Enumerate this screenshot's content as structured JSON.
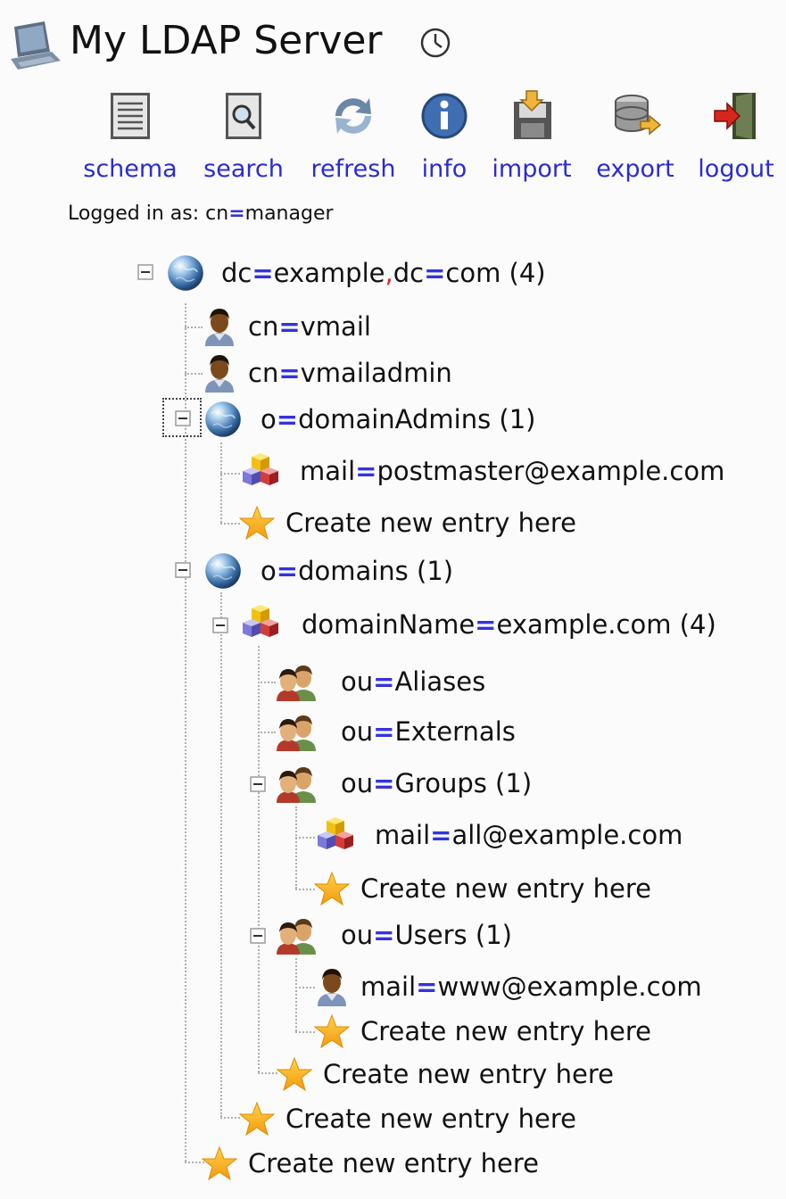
{
  "header": {
    "title": "My LDAP Server",
    "server_icon": "server-computer-icon",
    "clock_icon": "clock-icon"
  },
  "toolbar": [
    {
      "label": "schema",
      "icon": "schema-icon"
    },
    {
      "label": "search",
      "icon": "search-icon"
    },
    {
      "label": "refresh",
      "icon": "refresh-icon"
    },
    {
      "label": "info",
      "icon": "info-icon"
    },
    {
      "label": "import",
      "icon": "import-icon"
    },
    {
      "label": "export",
      "icon": "export-icon"
    },
    {
      "label": "logout",
      "icon": "logout-icon"
    }
  ],
  "login": {
    "prefix": "Logged in as: ",
    "attr": "cn",
    "eq": "=",
    "value": "manager"
  },
  "tree": {
    "root": {
      "attr1": "dc",
      "val1": "example",
      "sep": ",",
      "attr2": "dc",
      "val2": "com",
      "count": " (4)"
    },
    "vmail": {
      "attr": "cn",
      "value": "vmail"
    },
    "vmailadmin": {
      "attr": "cn",
      "value": "vmailadmin"
    },
    "domainAdmins": {
      "attr": "o",
      "value": "domainAdmins",
      "count": " (1)"
    },
    "postmaster": {
      "attr": "mail",
      "value": "postmaster@example.com"
    },
    "domains": {
      "attr": "o",
      "value": "domains",
      "count": " (1)"
    },
    "domainName": {
      "attr": "domainName",
      "value": "example.com",
      "count": " (4)"
    },
    "aliases": {
      "attr": "ou",
      "value": "Aliases"
    },
    "externals": {
      "attr": "ou",
      "value": "Externals"
    },
    "groups": {
      "attr": "ou",
      "value": "Groups",
      "count": " (1)"
    },
    "all": {
      "attr": "mail",
      "value": "all@example.com"
    },
    "users": {
      "attr": "ou",
      "value": "Users",
      "count": " (1)"
    },
    "www": {
      "attr": "mail",
      "value": "www@example.com"
    },
    "create_label": "Create new entry here",
    "eq": "="
  },
  "colors": {
    "link": "#2b2bd4",
    "equals": "#3333dd",
    "separator": "#e0242a"
  }
}
